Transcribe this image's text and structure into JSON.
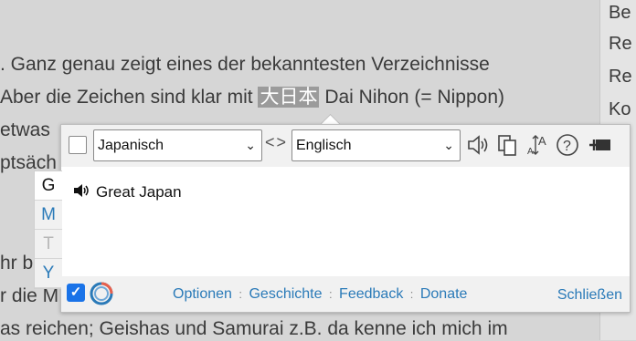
{
  "page": {
    "lines": [
      ". Ganz genau zeigt eines der bekanntesten Verzeichnisse",
      "Aber die Zeichen sind klar mit",
      "Dai Nihon (= Nippon)",
      "etwas",
      "ptsäch",
      "hr b",
      "r die M",
      "as reichen; Geishas und Samurai z.B. da kenne ich mich im"
    ],
    "highlight": "大日本",
    "right_column": [
      "Be",
      "Re",
      "Re",
      "Ko"
    ]
  },
  "popup": {
    "source_lang": "Japanisch",
    "target_lang": "Englisch",
    "swap_glyph": "<>",
    "tabs": [
      "G",
      "M",
      "T",
      "Y"
    ],
    "translation": "Great Japan",
    "tools": [
      "speaker-icon",
      "copy-icon",
      "font-size-icon",
      "help-icon",
      "pin-icon"
    ],
    "footer": {
      "checkbox_mark": "✓",
      "links": [
        "Optionen",
        "Geschichte",
        "Feedback",
        "Donate"
      ],
      "separator": ":",
      "close": "Schließen"
    }
  },
  "colors": {
    "link": "#2a7ab8",
    "checkbox": "#1a73e8",
    "highlight_bg": "#9b9b9b"
  }
}
